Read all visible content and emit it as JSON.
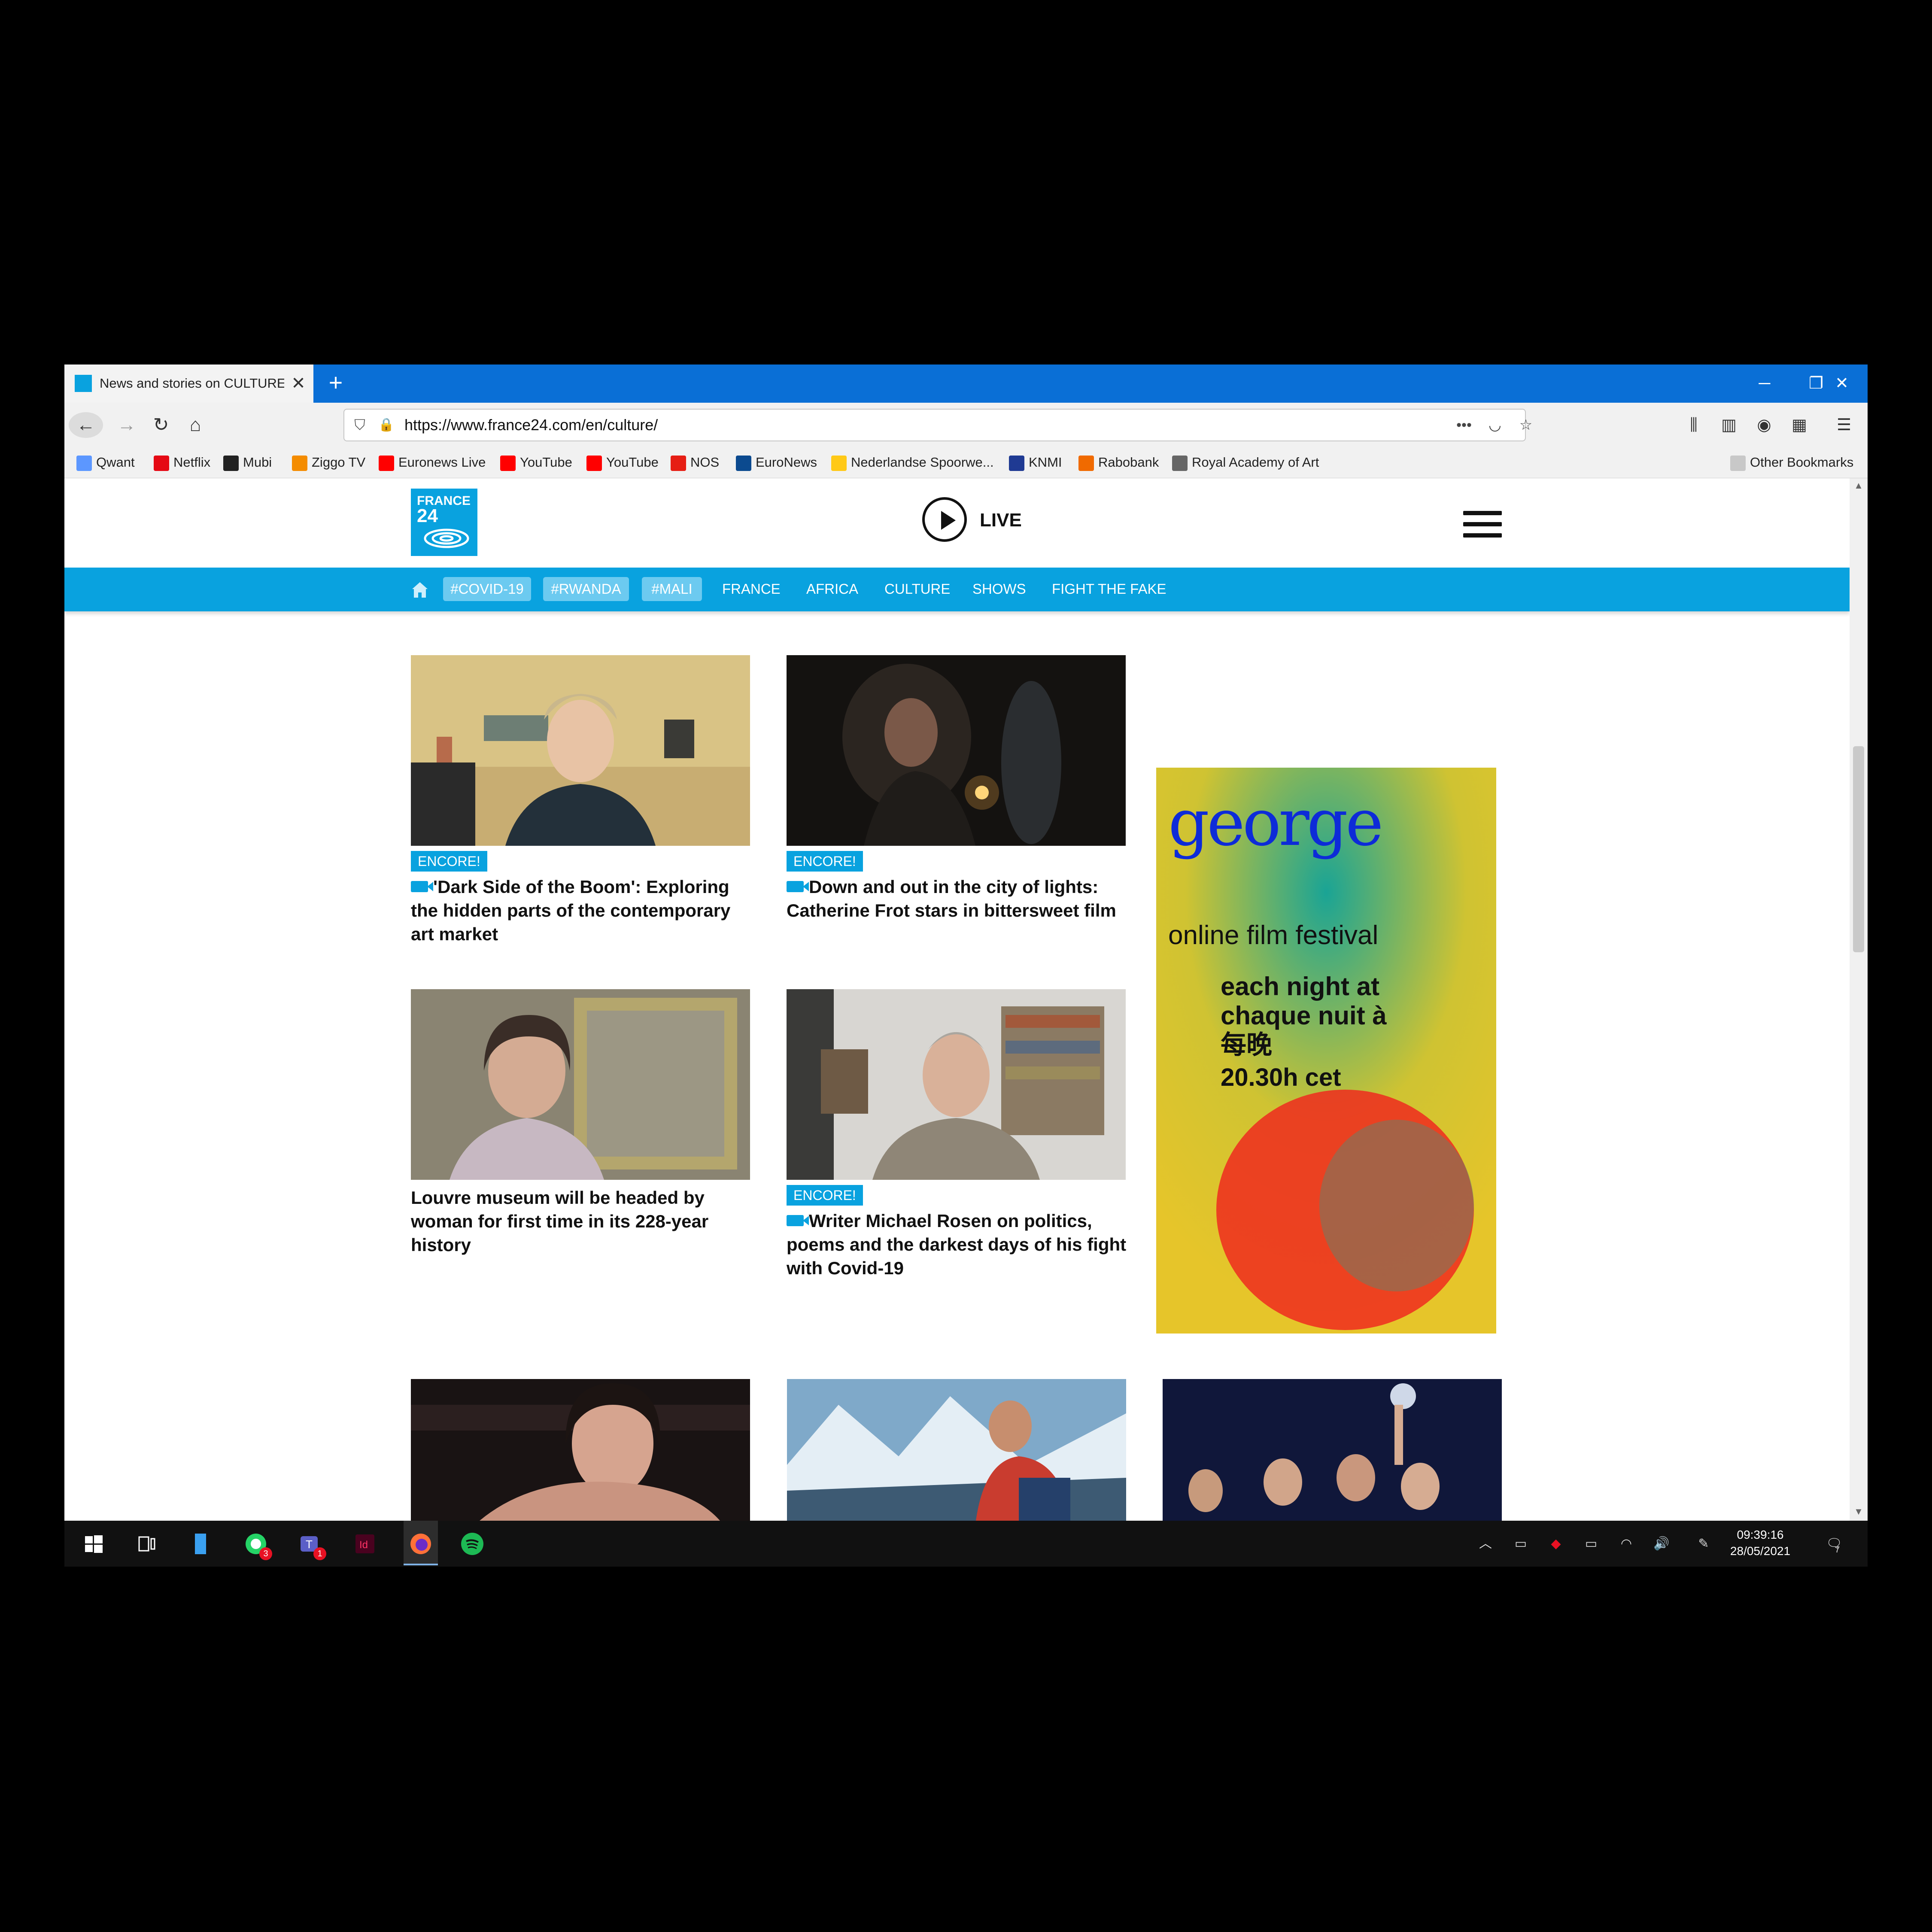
{
  "browser": {
    "tab_title": "News and stories on CULTURE",
    "tab_close": "✕",
    "new_tab": "+",
    "window_controls": {
      "minimize": "─",
      "restore": "❐",
      "close": "✕"
    },
    "url": "https://www.france24.com/en/culture/",
    "bookmarks": [
      {
        "label": "Qwant",
        "icon": "qwant-icon",
        "color": "#5c97ff"
      },
      {
        "label": "Netflix",
        "icon": "netflix-icon",
        "color": "#e50914"
      },
      {
        "label": "Mubi",
        "icon": "mubi-icon",
        "color": "#222222"
      },
      {
        "label": "Ziggo TV",
        "icon": "ziggo-icon",
        "color": "#f48c00"
      },
      {
        "label": "Euronews Live",
        "icon": "youtube-icon",
        "color": "#ff0000"
      },
      {
        "label": "YouTube",
        "icon": "youtube-icon",
        "color": "#ff0000"
      },
      {
        "label": "YouTube",
        "icon": "youtube-icon",
        "color": "#ff0000"
      },
      {
        "label": "NOS",
        "icon": "nos-icon",
        "color": "#e61e14"
      },
      {
        "label": "EuroNews",
        "icon": "euronews-icon",
        "color": "#0b4a8f"
      },
      {
        "label": "Nederlandse Spoorwe...",
        "icon": "ns-icon",
        "color": "#ffc917"
      },
      {
        "label": "KNMI",
        "icon": "knmi-icon",
        "color": "#1f3a93"
      },
      {
        "label": "Rabobank",
        "icon": "rabobank-icon",
        "color": "#f06a00"
      },
      {
        "label": "Royal Academy of Art",
        "icon": "globe-icon",
        "color": "#666666"
      }
    ],
    "other_bookmarks": "Other Bookmarks"
  },
  "site": {
    "logo_line1": "FRANCE",
    "logo_line2": "24",
    "live_label": "LIVE",
    "brand_color": "#09a2df",
    "nav_tags": [
      "#COVID-19",
      "#RWANDA",
      "#MALI"
    ],
    "nav_links": [
      "FRANCE",
      "AFRICA",
      "CULTURE",
      "SHOWS",
      "FIGHT THE FAKE"
    ]
  },
  "articles": [
    {
      "tag": "ENCORE!",
      "video": true,
      "headline": "'Dark Side of the Boom': Exploring the hidden parts of the contemporary art market"
    },
    {
      "tag": "ENCORE!",
      "video": true,
      "headline": "Down and out in the city of lights: Catherine Frot stars in bittersweet film"
    },
    {
      "tag": "",
      "video": false,
      "headline": "Louvre museum will be headed by woman for first time in its 228-year history"
    },
    {
      "tag": "ENCORE!",
      "video": true,
      "headline": "Writer Michael Rosen on politics, poems and the darkest days of his fight with Covid-19"
    }
  ],
  "ad": {
    "title": "george",
    "line1": "online film festival",
    "line2": "each night at\nchaque nuit à\n每晚",
    "line3": "20.30h cet"
  },
  "taskbar": {
    "apps": [
      {
        "name": "whatsapp",
        "badge": "3"
      },
      {
        "name": "teams",
        "badge": "1"
      }
    ],
    "time": "09:39:16",
    "date": "28/05/2021",
    "notification_count": "7"
  }
}
